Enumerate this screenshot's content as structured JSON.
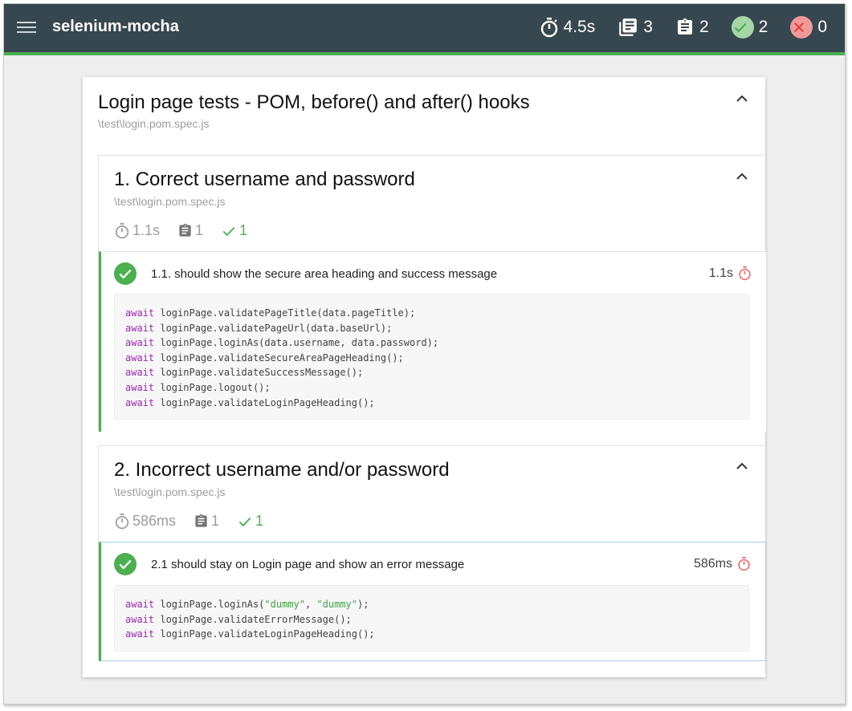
{
  "app": {
    "title": "selenium-mocha",
    "stats": {
      "duration": "4.5s",
      "suites": "3",
      "tests": "2",
      "passes": "2",
      "failures": "0"
    }
  },
  "colors": {
    "topbar": "#37474f",
    "accent_pass": "#4caf50",
    "fail": "#ef5350",
    "keyword": "#9c27b0",
    "string": "#43a047"
  },
  "suite": {
    "title": "Login page tests - POM, before() and after() hooks",
    "file": "\\test\\login.pom.spec.js",
    "subsuites": [
      {
        "title": "1. Correct username and password",
        "file": "\\test\\login.pom.spec.js",
        "duration": "1.1s",
        "tests": "1",
        "passes": "1",
        "test": {
          "title": "1.1. should show the secure area heading and success message",
          "duration": "1.1s",
          "code": [
            {
              "kw": "await",
              "rest": " loginPage.validatePageTitle(data.pageTitle);"
            },
            {
              "kw": "await",
              "rest": " loginPage.validatePageUrl(data.baseUrl);"
            },
            {
              "kw": "await",
              "rest": " loginPage.loginAs(data.username, data.password);"
            },
            {
              "kw": "await",
              "rest": " loginPage.validateSecureAreaPageHeading();"
            },
            {
              "kw": "await",
              "rest": " loginPage.validateSuccessMessage();"
            },
            {
              "kw": "await",
              "rest": " loginPage.logout();"
            },
            {
              "kw": "await",
              "rest": " loginPage.validateLoginPageHeading();"
            }
          ]
        }
      },
      {
        "title": "2. Incorrect username and/or password",
        "file": "\\test\\login.pom.spec.js",
        "duration": "586ms",
        "tests": "1",
        "passes": "1",
        "test": {
          "title": "2.1 should stay on Login page and show an error message",
          "duration": "586ms",
          "code": [
            {
              "kw": "await",
              "pre": " loginPage.loginAs(",
              "s1": "\"dummy\"",
              "mid": ", ",
              "s2": "\"dummy\"",
              "post": ");"
            },
            {
              "kw": "await",
              "rest": " loginPage.validateErrorMessage();"
            },
            {
              "kw": "await",
              "rest": " loginPage.validateLoginPageHeading();"
            }
          ]
        }
      }
    ]
  }
}
